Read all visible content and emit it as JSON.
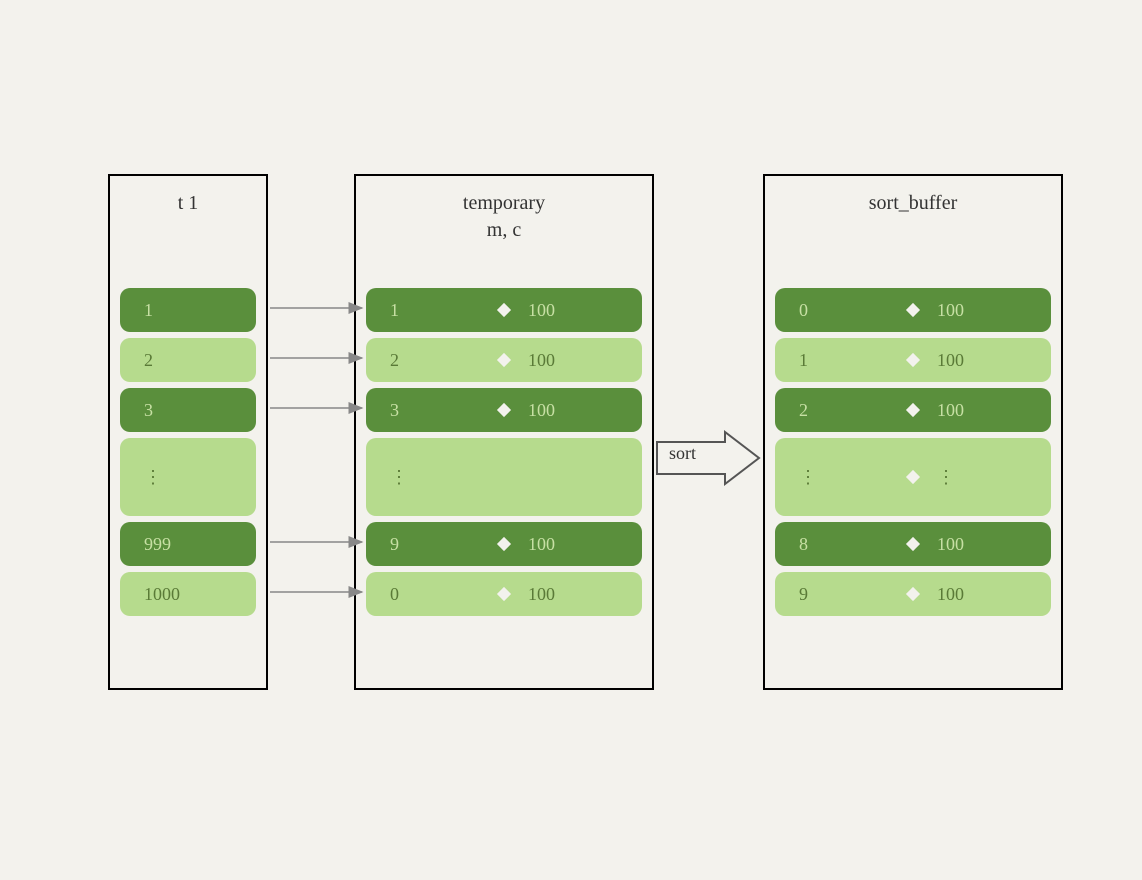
{
  "boxes": {
    "t1": {
      "title": "t 1",
      "rows": [
        {
          "style": "dark",
          "val": "1"
        },
        {
          "style": "light",
          "val": "2"
        },
        {
          "style": "dark",
          "val": "3"
        },
        {
          "style": "light",
          "val": "⋮"
        },
        {
          "style": "dark",
          "val": "999"
        },
        {
          "style": "light",
          "val": "1000"
        }
      ]
    },
    "temporary": {
      "title_line1": "temporary",
      "title_line2": "m, c",
      "rows": [
        {
          "style": "dark",
          "left": "1",
          "right": "100"
        },
        {
          "style": "light",
          "left": "2",
          "right": "100"
        },
        {
          "style": "dark",
          "left": "3",
          "right": "100"
        },
        {
          "style": "light",
          "left": "⋮",
          "right": ""
        },
        {
          "style": "dark",
          "left": "9",
          "right": "100"
        },
        {
          "style": "light",
          "left": "0",
          "right": "100"
        }
      ]
    },
    "sort_buffer": {
      "title": "sort_buffer",
      "rows": [
        {
          "style": "dark",
          "left": "0",
          "right": "100"
        },
        {
          "style": "light",
          "left": "1",
          "right": "100"
        },
        {
          "style": "dark",
          "left": "2",
          "right": "100"
        },
        {
          "style": "light",
          "left": "⋮",
          "right": "⋮"
        },
        {
          "style": "dark",
          "left": "8",
          "right": "100"
        },
        {
          "style": "light",
          "left": "9",
          "right": "100"
        }
      ]
    }
  },
  "sort_label": "sort",
  "colors": {
    "dark_green": "#5a8f3c",
    "light_green": "#b6db8d",
    "background": "#f3f2ed"
  }
}
